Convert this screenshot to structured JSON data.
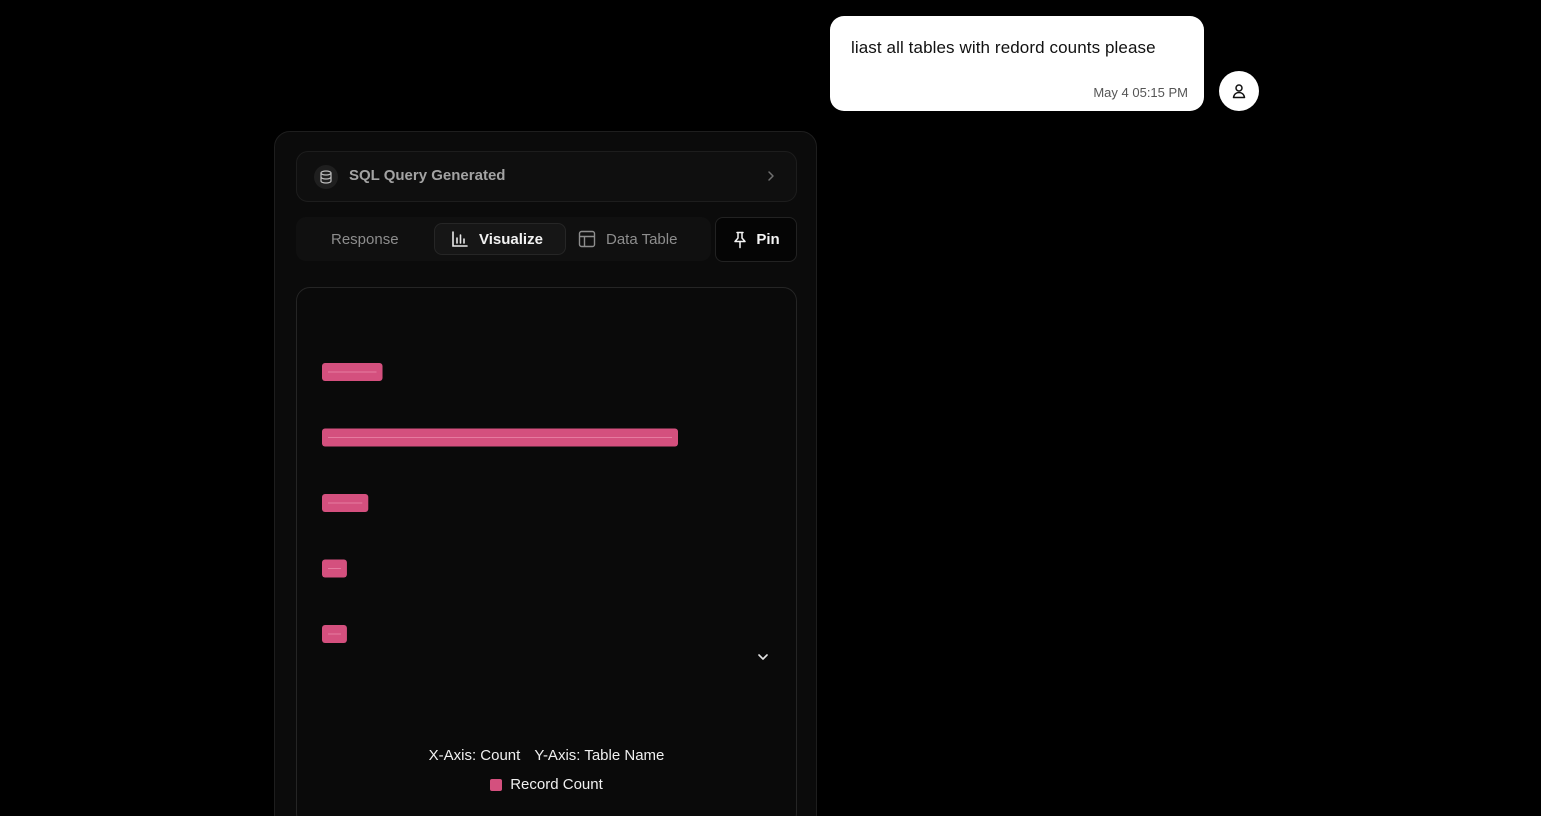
{
  "user_message": {
    "text": "liast all tables with redord counts please",
    "time": "May 4 05:15 PM"
  },
  "assistant": {
    "sql_header": {
      "label": "SQL Query Generated"
    },
    "tabs": [
      {
        "label": "Response",
        "active": false
      },
      {
        "label": "Visualize",
        "active": true
      },
      {
        "label": "Data Table",
        "active": false
      }
    ],
    "pin_label": "Pin",
    "chart_caption": {
      "x_axis": "X-Axis: Count",
      "y_axis": "Y-Axis: Table Name"
    },
    "legend_label": "Record Count"
  },
  "colors": {
    "bar": "#d4507e",
    "bar_highlight": "#e67ba0"
  },
  "chart_data": {
    "type": "bar",
    "orientation": "horizontal",
    "categories": [
      "",
      "",
      "",
      "",
      ""
    ],
    "series": [
      {
        "name": "Record Count",
        "values": [
          17,
          100,
          13,
          7,
          7
        ]
      }
    ],
    "xlabel": "Count",
    "ylabel": "Table Name",
    "xlim": [
      0,
      125
    ]
  }
}
